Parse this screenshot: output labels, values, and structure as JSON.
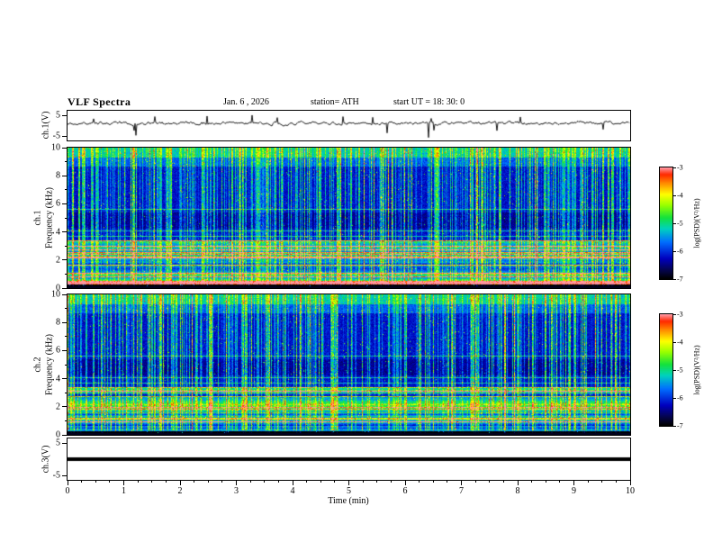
{
  "figure": {
    "title": "VLF Spectra",
    "date": "Jan. 6 , 2026",
    "station": "station= ATH",
    "start_ut": "start UT =  18: 30: 0"
  },
  "x_axis": {
    "label": "Time (min)",
    "ticks": [
      "0",
      "1",
      "2",
      "3",
      "4",
      "5",
      "6",
      "7",
      "8",
      "9",
      "10"
    ],
    "range": [
      0,
      10
    ]
  },
  "panels": [
    {
      "id": "ch1-wave",
      "ylabel": "ch.1(V)",
      "yticks": [
        "5",
        "-5"
      ],
      "ylim": [
        -5,
        5
      ],
      "type": "line"
    },
    {
      "id": "ch1-spec",
      "ylabel_channel": "ch.1",
      "ylabel_axis": "Frequency (kHz)",
      "yticks": [
        "10",
        "8",
        "6",
        "4",
        "2",
        "0"
      ],
      "ylim": [
        0,
        10
      ],
      "type": "heatmap"
    },
    {
      "id": "ch2-spec",
      "ylabel_channel": "ch.2",
      "ylabel_axis": "Frequency (kHz)",
      "yticks": [
        "10",
        "8",
        "6",
        "4",
        "2",
        "0"
      ],
      "ylim": [
        0,
        10
      ],
      "type": "heatmap"
    },
    {
      "id": "ch3-wave",
      "ylabel": "ch.3(V)",
      "yticks": [
        "5",
        "-5"
      ],
      "ylim": [
        -5,
        5
      ],
      "type": "line"
    }
  ],
  "colorbar": {
    "label": "log(PSD)(V²/Hz)",
    "ticks": [
      "-3",
      "-4",
      "-5",
      "-6",
      "-7"
    ],
    "range": [
      -7,
      -3
    ]
  },
  "chart_data": [
    {
      "type": "line",
      "name": "ch.1(V)",
      "xlabel": "Time (min)",
      "xlim": [
        0,
        10
      ],
      "ylabel": "ch.1(V)",
      "ylim": [
        -5,
        5
      ],
      "yticks": [
        5,
        -5
      ],
      "description": "Broadband noisy voltage waveform centered near 0 V with small ~±1 V fluctuations and intermittent impulsive negative spikes reaching about -5 V across the full 0–10 min record."
    },
    {
      "type": "heatmap",
      "name": "ch.1 spectrogram",
      "xlabel": "Time (min)",
      "xlim": [
        0,
        10
      ],
      "ylabel": "Frequency (kHz)",
      "ylim": [
        0,
        10
      ],
      "yticks": [
        0,
        2,
        4,
        6,
        8,
        10
      ],
      "zlabel": "log(PSD)(V²/Hz)",
      "zlim": [
        -7,
        -3
      ],
      "description": "VLF power spectral density: deep-blue (~-6.5) background above ~4 kHz crossed by dense vertical sferic streaks (green/yellow, ~-5 to -4); strong quasi-horizontal emission bands (green/yellow/red, ~-4.5 to -3) below ~3 kHz; dark strip at 0 kHz; enhanced speckle near 10 kHz."
    },
    {
      "type": "heatmap",
      "name": "ch.2 spectrogram",
      "xlabel": "Time (min)",
      "xlim": [
        0,
        10
      ],
      "ylabel": "Frequency (kHz)",
      "ylim": [
        0,
        10
      ],
      "yticks": [
        0,
        2,
        4,
        6,
        8,
        10
      ],
      "zlabel": "log(PSD)(V²/Hz)",
      "zlim": [
        -7,
        -3
      ],
      "description": "Same structure as ch.1: blue background with vertical sferic streaks above ~4 kHz and bright banded emissions (several red/yellow horizontal lines, ~-4 to -3) below ~3 kHz; dark strip at 0 kHz."
    },
    {
      "type": "line",
      "name": "ch.3(V)",
      "xlabel": "Time (min)",
      "xlim": [
        0,
        10
      ],
      "ylabel": "ch.3(V)",
      "ylim": [
        -5,
        5
      ],
      "yticks": [
        5,
        -5
      ],
      "description": "Constant 0 V — flat thick black line for the whole record (channel off / no signal)."
    }
  ]
}
